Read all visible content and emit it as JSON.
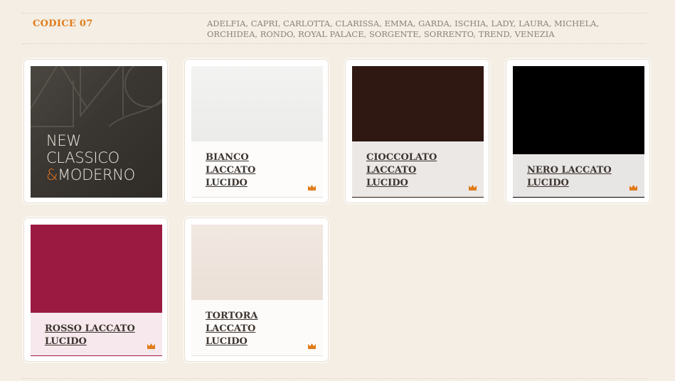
{
  "header": {
    "code_title": "CODICE 07",
    "models": "ADELFIA, CAPRI, CARLOTTA, CLARISSA, EMMA, GARDA, ISCHIA, LADY, LAURA, MICHELA, ORCHIDEA, RONDO, ROYAL PALACE, SORGENTE, SORRENTO, TREND, VENEZIA"
  },
  "colors": {
    "accent": "#e07c1a",
    "label": "#3d3530",
    "background": "#f4eee4"
  },
  "promo": {
    "line1": "NEW",
    "line2": "CLASSICO",
    "amp": "&",
    "line3": "MODERNO"
  },
  "finishes": [
    {
      "name": "BIANCO LACCATO LUCIDO",
      "line1": "BIANCO",
      "line2": "LACCATO",
      "line3": "LUCIDO",
      "color": "#efefee",
      "icon": "crown-icon"
    },
    {
      "name": "CIOCCOLATO LACCATO LUCIDO",
      "line1": "CIOCCOLATO",
      "line2": "LACCATO",
      "line3": "LUCIDO",
      "color": "#2f1812",
      "icon": "crown-icon"
    },
    {
      "name": "NERO LACCATO LUCIDO",
      "line1": "NERO LACCATO",
      "line2": "LUCIDO",
      "color": "#000000",
      "icon": "crown-icon"
    },
    {
      "name": "ROSSO LACCATO LUCIDO",
      "line1": "ROSSO LACCATO",
      "line2": "LUCIDO",
      "color": "#9b1a42",
      "icon": "crown-icon"
    },
    {
      "name": "TORTORA LACCATO LUCIDO",
      "line1": "TORTORA",
      "line2": "LACCATO",
      "line3": "LUCIDO",
      "color": "#efe5dd",
      "icon": "crown-icon"
    }
  ]
}
